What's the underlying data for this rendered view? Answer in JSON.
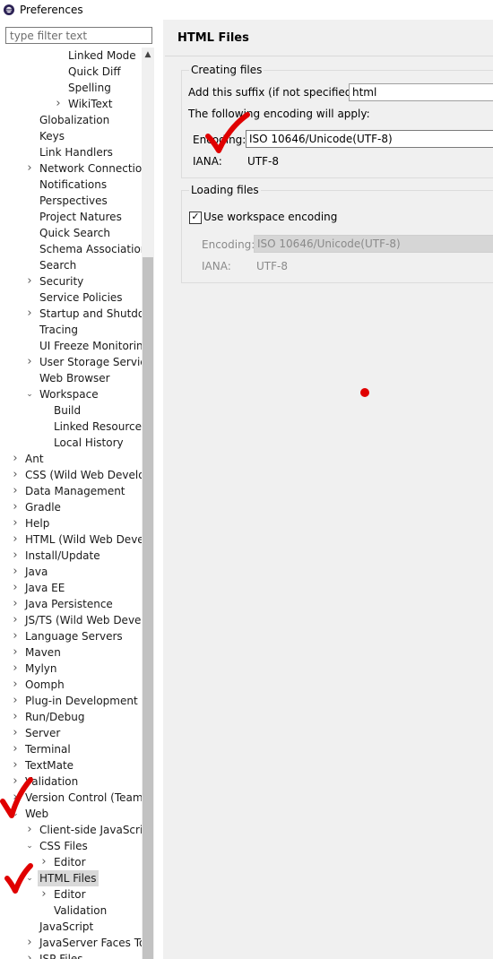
{
  "window": {
    "title": "Preferences",
    "icon": "eclipse-icon"
  },
  "filter": {
    "placeholder": "type filter text"
  },
  "tree": [
    {
      "label": "Linked Mode",
      "level": 3,
      "arrow": "none"
    },
    {
      "label": "Quick Diff",
      "level": 3,
      "arrow": "none"
    },
    {
      "label": "Spelling",
      "level": 3,
      "arrow": "none"
    },
    {
      "label": "WikiText",
      "level": 3,
      "arrow": "collapsed"
    },
    {
      "label": "Globalization",
      "level": 1,
      "arrow": "none"
    },
    {
      "label": "Keys",
      "level": 1,
      "arrow": "none"
    },
    {
      "label": "Link Handlers",
      "level": 1,
      "arrow": "none"
    },
    {
      "label": "Network Connections",
      "level": 1,
      "arrow": "collapsed"
    },
    {
      "label": "Notifications",
      "level": 1,
      "arrow": "none"
    },
    {
      "label": "Perspectives",
      "level": 1,
      "arrow": "none"
    },
    {
      "label": "Project Natures",
      "level": 1,
      "arrow": "none"
    },
    {
      "label": "Quick Search",
      "level": 1,
      "arrow": "none"
    },
    {
      "label": "Schema Associations",
      "level": 1,
      "arrow": "none"
    },
    {
      "label": "Search",
      "level": 1,
      "arrow": "none"
    },
    {
      "label": "Security",
      "level": 1,
      "arrow": "collapsed"
    },
    {
      "label": "Service Policies",
      "level": 1,
      "arrow": "none"
    },
    {
      "label": "Startup and Shutdown",
      "level": 1,
      "arrow": "collapsed"
    },
    {
      "label": "Tracing",
      "level": 1,
      "arrow": "none"
    },
    {
      "label": "UI Freeze Monitoring",
      "level": 1,
      "arrow": "none"
    },
    {
      "label": "User Storage Service",
      "level": 1,
      "arrow": "collapsed"
    },
    {
      "label": "Web Browser",
      "level": 1,
      "arrow": "none"
    },
    {
      "label": "Workspace",
      "level": 1,
      "arrow": "expanded"
    },
    {
      "label": "Build",
      "level": 2,
      "arrow": "none"
    },
    {
      "label": "Linked Resources",
      "level": 2,
      "arrow": "none"
    },
    {
      "label": "Local History",
      "level": 2,
      "arrow": "none"
    },
    {
      "label": "Ant",
      "level": 0,
      "arrow": "collapsed"
    },
    {
      "label": "CSS (Wild Web Developer)",
      "level": 0,
      "arrow": "collapsed"
    },
    {
      "label": "Data Management",
      "level": 0,
      "arrow": "collapsed"
    },
    {
      "label": "Gradle",
      "level": 0,
      "arrow": "collapsed"
    },
    {
      "label": "Help",
      "level": 0,
      "arrow": "collapsed"
    },
    {
      "label": "HTML (Wild Web Developer)",
      "level": 0,
      "arrow": "collapsed"
    },
    {
      "label": "Install/Update",
      "level": 0,
      "arrow": "collapsed"
    },
    {
      "label": "Java",
      "level": 0,
      "arrow": "collapsed"
    },
    {
      "label": "Java EE",
      "level": 0,
      "arrow": "collapsed"
    },
    {
      "label": "Java Persistence",
      "level": 0,
      "arrow": "collapsed"
    },
    {
      "label": "JS/TS (Wild Web Developer)",
      "level": 0,
      "arrow": "collapsed"
    },
    {
      "label": "Language Servers",
      "level": 0,
      "arrow": "collapsed"
    },
    {
      "label": "Maven",
      "level": 0,
      "arrow": "collapsed"
    },
    {
      "label": "Mylyn",
      "level": 0,
      "arrow": "collapsed"
    },
    {
      "label": "Oomph",
      "level": 0,
      "arrow": "collapsed"
    },
    {
      "label": "Plug-in Development",
      "level": 0,
      "arrow": "collapsed"
    },
    {
      "label": "Run/Debug",
      "level": 0,
      "arrow": "collapsed"
    },
    {
      "label": "Server",
      "level": 0,
      "arrow": "collapsed"
    },
    {
      "label": "Terminal",
      "level": 0,
      "arrow": "collapsed"
    },
    {
      "label": "TextMate",
      "level": 0,
      "arrow": "collapsed"
    },
    {
      "label": "Validation",
      "level": 0,
      "arrow": "collapsed"
    },
    {
      "label": "Version Control (Team)",
      "level": 0,
      "arrow": "collapsed"
    },
    {
      "label": "Web",
      "level": 0,
      "arrow": "expanded"
    },
    {
      "label": "Client-side JavaScript",
      "level": 1,
      "arrow": "collapsed"
    },
    {
      "label": "CSS Files",
      "level": 1,
      "arrow": "expanded"
    },
    {
      "label": "Editor",
      "level": 2,
      "arrow": "collapsed"
    },
    {
      "label": "HTML Files",
      "level": 1,
      "arrow": "expanded",
      "selected": true
    },
    {
      "label": "Editor",
      "level": 2,
      "arrow": "collapsed"
    },
    {
      "label": "Validation",
      "level": 2,
      "arrow": "none"
    },
    {
      "label": "JavaScript",
      "level": 1,
      "arrow": "none"
    },
    {
      "label": "JavaServer Faces Tools",
      "level": 1,
      "arrow": "collapsed"
    },
    {
      "label": "JSP Files",
      "level": 1,
      "arrow": "collapsed"
    }
  ],
  "page": {
    "title": "HTML Files",
    "creating": {
      "group_label": "Creating files",
      "suffix_label": "Add this suffix (if not specified):",
      "suffix_value": "html",
      "encoding_note": "The following encoding will apply:",
      "encoding_label": "Encoding:",
      "encoding_value": "ISO 10646/Unicode(UTF-8)",
      "iana_label": "IANA:",
      "iana_value": "UTF-8"
    },
    "loading": {
      "group_label": "Loading files",
      "checkbox_label": "Use workspace encoding",
      "checkbox_checked": true,
      "encoding_label": "Encoding:",
      "encoding_value": "ISO 10646/Unicode(UTF-8)",
      "iana_label": "IANA:",
      "iana_value": "UTF-8"
    }
  },
  "annotations": {
    "mark_color": "#e00000"
  }
}
